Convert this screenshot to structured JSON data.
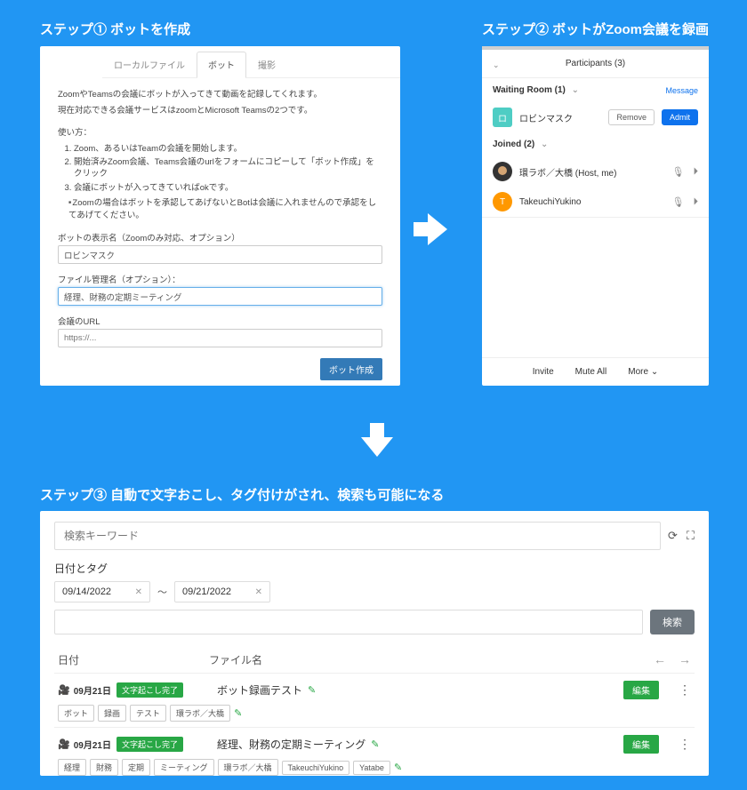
{
  "step1": {
    "title": "ステップ① ボットを作成",
    "tabs": [
      "ローカルファイル",
      "ボット",
      "撮影"
    ],
    "intro1": "ZoomやTeamsの会議にボットが入ってきて動画を記録してくれます。",
    "intro2": "現在対応できる会議サービスはzoomとMicrosoft Teamsの2つです。",
    "howto_label": "使い方：",
    "howto": [
      "Zoom、あるいはTeamの会議を開始します。",
      "開始済みZoom会議、Teams会議のurlをフォームにコピーして「ボット作成」をクリック",
      "会議にボットが入ってきていればokです。"
    ],
    "howto_sub": "Zoomの場合はボットを承認してあげないとBotは会議に入れませんので承認をしてあげてください。",
    "field_botname_label": "ボットの表示名（Zoomのみ対応、オプション）",
    "field_botname_value": "ロビンマスク",
    "field_filename_label": "ファイル管理名（オプション）：",
    "field_filename_value": "経理、財務の定期ミーティング",
    "field_url_label": "会議のURL",
    "field_url_placeholder": "https://...",
    "btn_create": "ボット作成"
  },
  "step2": {
    "title": "ステップ② ボットがZoom会議を録画",
    "participants_title": "Participants (3)",
    "waiting_label": "Waiting Room (1)",
    "message_link": "Message",
    "waiting_name": "ロビンマスク",
    "btn_remove": "Remove",
    "btn_admit": "Admit",
    "joined_label": "Joined (2)",
    "joined": [
      {
        "name": "環ラボ／大橋 (Host, me)"
      },
      {
        "name": "TakeuchiYukino"
      }
    ],
    "footer": [
      "Invite",
      "Mute All",
      "More"
    ]
  },
  "step3": {
    "title": "ステップ③ 自動で文字おこし、タグ付けがされ、検索も可能になる",
    "search_placeholder": "検索キーワード",
    "date_tag_label": "日付とタグ",
    "date_from": "09/14/2022",
    "date_to": "09/21/2022",
    "btn_search": "検索",
    "col_date": "日付",
    "col_file": "ファイル名",
    "rows": [
      {
        "date": "09月21日",
        "status": "文字起こし完了",
        "title": "ボット録画テスト",
        "btn_edit": "編集",
        "tags": [
          "ボット",
          "録画",
          "テスト",
          "環ラボ／大橋"
        ]
      },
      {
        "date": "09月21日",
        "status": "文字起こし完了",
        "title": "経理、財務の定期ミーティング",
        "btn_edit": "編集",
        "tags": [
          "経理",
          "財務",
          "定期",
          "ミーティング",
          "環ラボ／大橋",
          "TakeuchiYukino",
          "Yatabe"
        ]
      }
    ]
  }
}
